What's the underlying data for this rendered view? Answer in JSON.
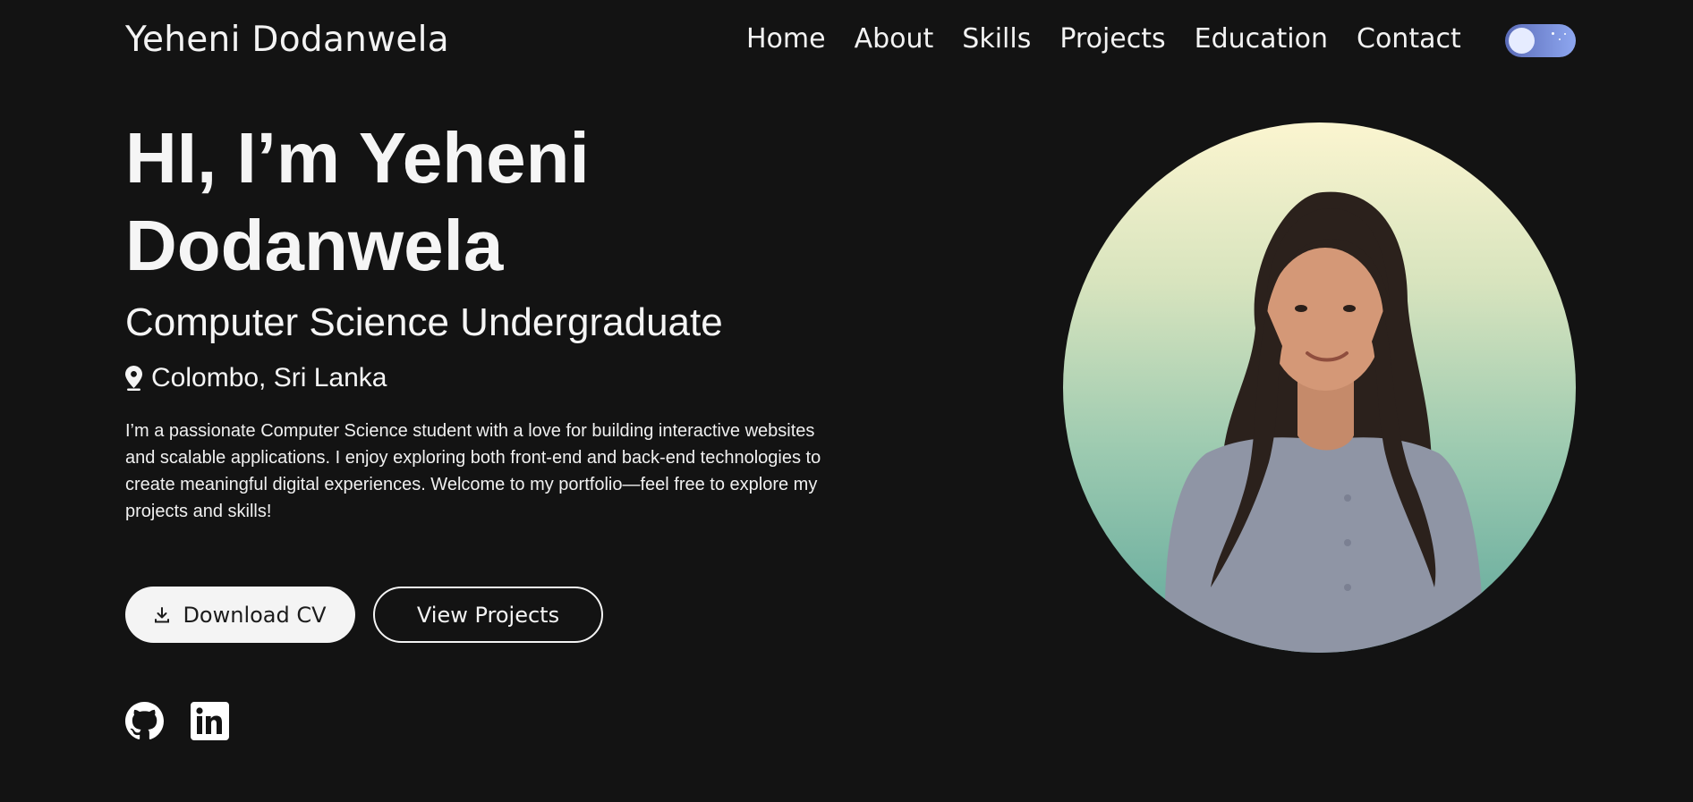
{
  "header": {
    "brand": "Yeheni Dodanwela",
    "nav": [
      "Home",
      "About",
      "Skills",
      "Projects",
      "Education",
      "Contact"
    ]
  },
  "hero": {
    "title_line1": "HI, I’m Yeheni",
    "title_line2": "Dodanwela",
    "subtitle": "Computer Science Undergraduate",
    "location": "Colombo, Sri Lanka",
    "bio": "I’m a passionate Computer Science student with a love for building interactive websites and scalable applications. I enjoy exploring both front-end and back-end technologies to create meaningful digital experiences. Welcome to my portfolio—feel free to explore my projects and skills!",
    "download_cv_label": "Download CV",
    "view_projects_label": "View Projects"
  },
  "icons": {
    "location": "location-pin-icon",
    "download": "download-icon",
    "github": "github-icon",
    "linkedin": "linkedin-icon",
    "theme_toggle": "dark-mode-toggle"
  },
  "colors": {
    "background": "#131313",
    "text": "#f5f5f5",
    "toggle": "#6f84d6",
    "portrait_gradient_top": "#fbf5d0",
    "portrait_gradient_bottom": "#5fa79b"
  }
}
